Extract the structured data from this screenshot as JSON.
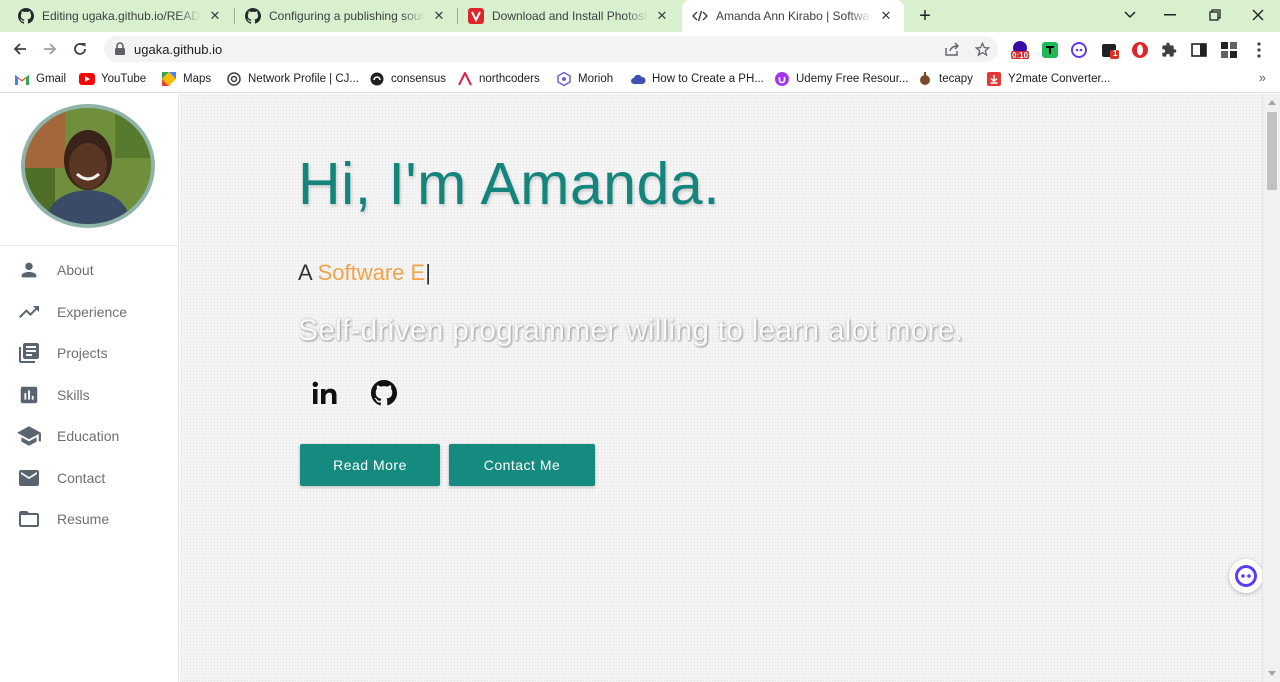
{
  "browser": {
    "tabs": [
      {
        "title": "Editing ugaka.github.io/README.md",
        "icon": "github-icon"
      },
      {
        "title": "Configuring a publishing source for",
        "icon": "github-icon"
      },
      {
        "title": "Download and Install Photoshop",
        "icon": "vivaldi-icon"
      },
      {
        "title": "Amanda Ann Kirabo | Software Eng",
        "icon": "code-icon"
      }
    ],
    "address": "ugaka.github.io",
    "extension_badge": "0:10",
    "extension_count": "1",
    "bookmarks": [
      {
        "label": "Gmail",
        "icon": "gmail-icon"
      },
      {
        "label": "YouTube",
        "icon": "youtube-icon"
      },
      {
        "label": "Maps",
        "icon": "maps-icon"
      },
      {
        "label": "Network Profile | CJ...",
        "icon": "network-icon"
      },
      {
        "label": "consensus",
        "icon": "consensus-icon"
      },
      {
        "label": "northcoders",
        "icon": "northcoders-icon"
      },
      {
        "label": "Morioh",
        "icon": "morioh-icon"
      },
      {
        "label": "How to Create a PH...",
        "icon": "cloud-icon"
      },
      {
        "label": "Udemy Free Resour...",
        "icon": "udemy-icon"
      },
      {
        "label": "tecapy",
        "icon": "tecapy-icon"
      },
      {
        "label": "Y2mate Converter...",
        "icon": "y2mate-icon"
      }
    ]
  },
  "sidebar": {
    "items": [
      {
        "label": "About",
        "icon": "person-icon"
      },
      {
        "label": "Experience",
        "icon": "trending-icon"
      },
      {
        "label": "Projects",
        "icon": "library-icon"
      },
      {
        "label": "Skills",
        "icon": "bar-chart-icon"
      },
      {
        "label": "Education",
        "icon": "school-icon"
      },
      {
        "label": "Contact",
        "icon": "mail-icon"
      },
      {
        "label": "Resume",
        "icon": "folder-icon"
      }
    ]
  },
  "hero": {
    "title": "Hi, I'm Amanda.",
    "typed_prefix": "A",
    "typed_text": "Software E",
    "caret": "|",
    "tagline": "Self-driven programmer willing to learn alot more.",
    "read_more_label": "Read More",
    "contact_label": "Contact Me"
  },
  "colors": {
    "accent": "#158a7e",
    "title": "#14857c",
    "typed": "#f2a34a",
    "tab_strip": "#d9f0cf"
  }
}
